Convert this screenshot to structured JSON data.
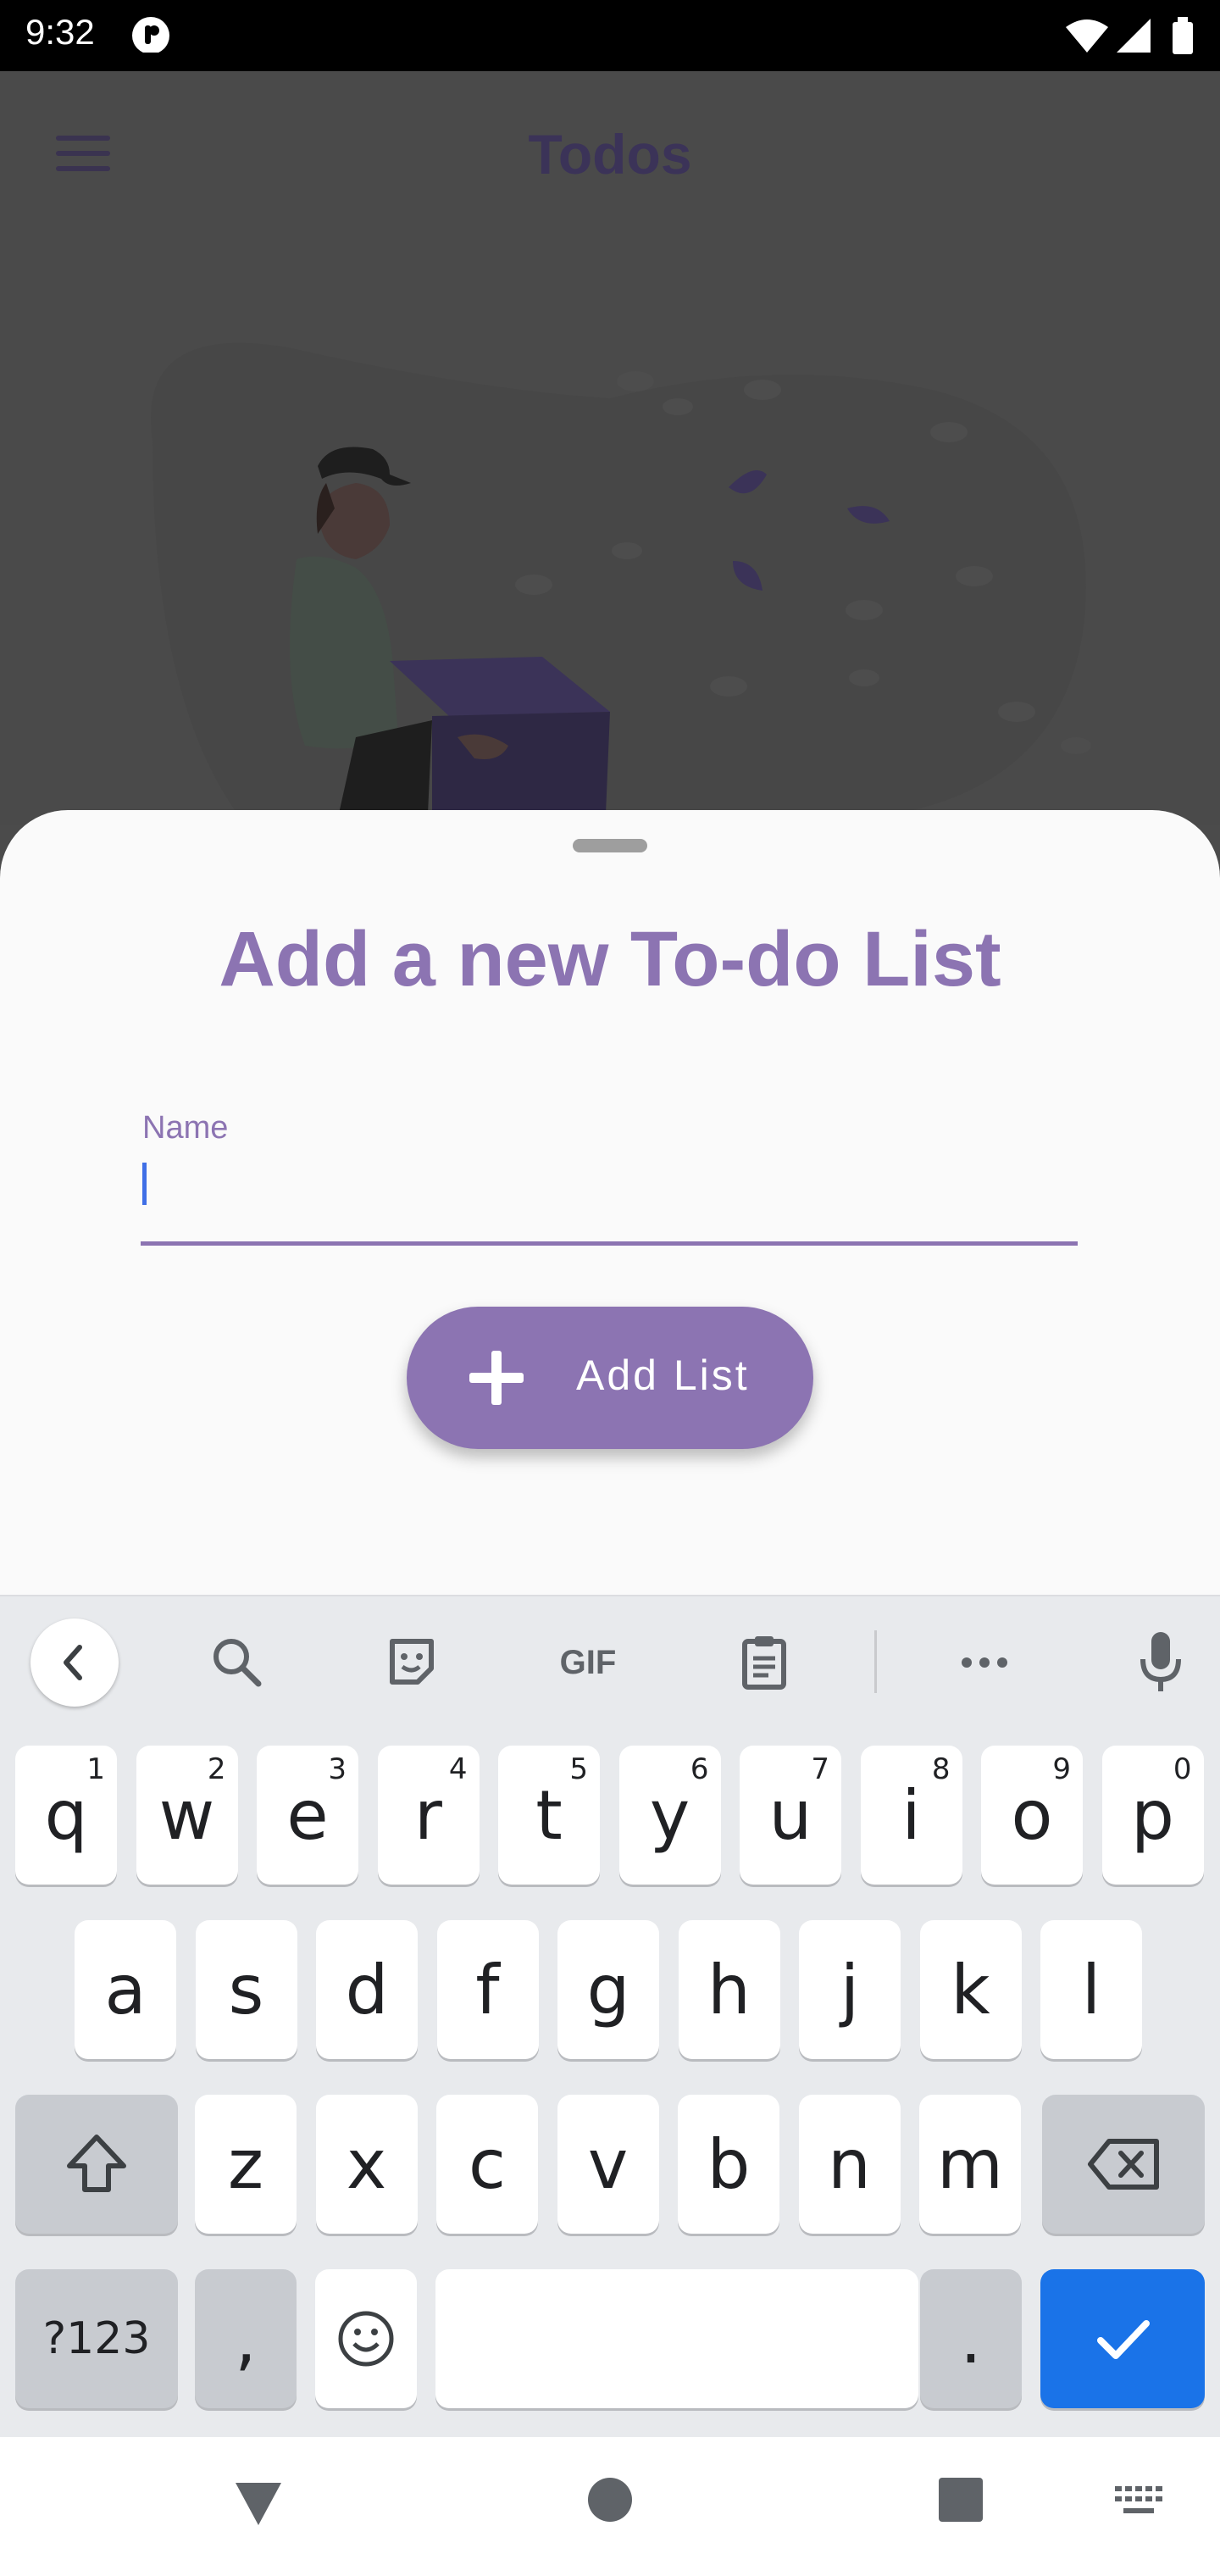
{
  "status_bar": {
    "time": "9:32"
  },
  "app_bar": {
    "title": "Todos"
  },
  "sheet": {
    "title": "Add a new To-do List",
    "name_field": {
      "label": "Name",
      "value": ""
    },
    "add_button_label": "Add List"
  },
  "keyboard": {
    "toolbar": {
      "gif_label": "GIF"
    },
    "row1": [
      {
        "key": "q",
        "hint": "1"
      },
      {
        "key": "w",
        "hint": "2"
      },
      {
        "key": "e",
        "hint": "3"
      },
      {
        "key": "r",
        "hint": "4"
      },
      {
        "key": "t",
        "hint": "5"
      },
      {
        "key": "y",
        "hint": "6"
      },
      {
        "key": "u",
        "hint": "7"
      },
      {
        "key": "i",
        "hint": "8"
      },
      {
        "key": "o",
        "hint": "9"
      },
      {
        "key": "p",
        "hint": "0"
      }
    ],
    "row2": [
      "a",
      "s",
      "d",
      "f",
      "g",
      "h",
      "j",
      "k",
      "l"
    ],
    "row3": [
      "z",
      "x",
      "c",
      "v",
      "b",
      "n",
      "m"
    ],
    "symbols_label": "?123",
    "comma": ",",
    "period": "."
  },
  "colors": {
    "accent": "#8c74b2",
    "enter": "#1a73e8"
  }
}
